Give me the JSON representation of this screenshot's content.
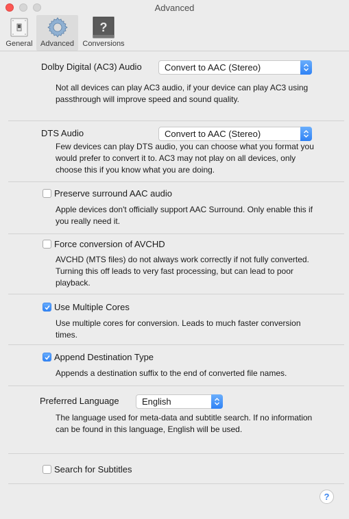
{
  "window": {
    "title": "Advanced"
  },
  "toolbar": {
    "items": [
      {
        "label": "General",
        "icon": "toggle-switch-icon",
        "selected": false
      },
      {
        "label": "Advanced",
        "icon": "gear-icon",
        "selected": true
      },
      {
        "label": "Conversions",
        "icon": "question-box-icon",
        "selected": false
      }
    ]
  },
  "settings": {
    "ac3": {
      "label": "Dolby Digital (AC3) Audio",
      "selected": "Convert to AAC (Stereo)",
      "description": "Not all devices can play AC3 audio, if your device can play AC3 using passthrough will improve speed and sound quality."
    },
    "dts": {
      "label": "DTS Audio",
      "selected": "Convert to AAC (Stereo)",
      "description": "Few devices can play DTS audio, you can choose what you format you would prefer to convert it to.  AC3 may not play on all devices, only choose this if you know what you are doing."
    },
    "preserve_surround": {
      "label": "Preserve surround AAC audio",
      "checked": false,
      "description": "Apple devices don't officially support AAC Surround. Only enable this if you really need it."
    },
    "force_avchd": {
      "label": "Force conversion of AVCHD",
      "checked": false,
      "description": "AVCHD (MTS files) do not always work correctly if not fully converted. Turning this off leads to very fast processing, but can lead to poor playback."
    },
    "multiple_cores": {
      "label": "Use Multiple Cores",
      "checked": true,
      "description": "Use multiple cores for conversion. Leads to much faster conversion times."
    },
    "append_destination": {
      "label": "Append Destination Type",
      "checked": true,
      "description": "Appends a destination suffix to the end of converted file names."
    },
    "preferred_language": {
      "label": "Preferred Language",
      "selected": "English",
      "description": "The language used for meta-data and subtitle search. If no information can be found in this language, English will be used."
    },
    "search_subtitles": {
      "label": "Search for Subtitles",
      "checked": false
    }
  },
  "help": {
    "label": "?"
  },
  "colors": {
    "accent": "#3c86f0",
    "close": "#fc5753",
    "background": "#ececec"
  }
}
